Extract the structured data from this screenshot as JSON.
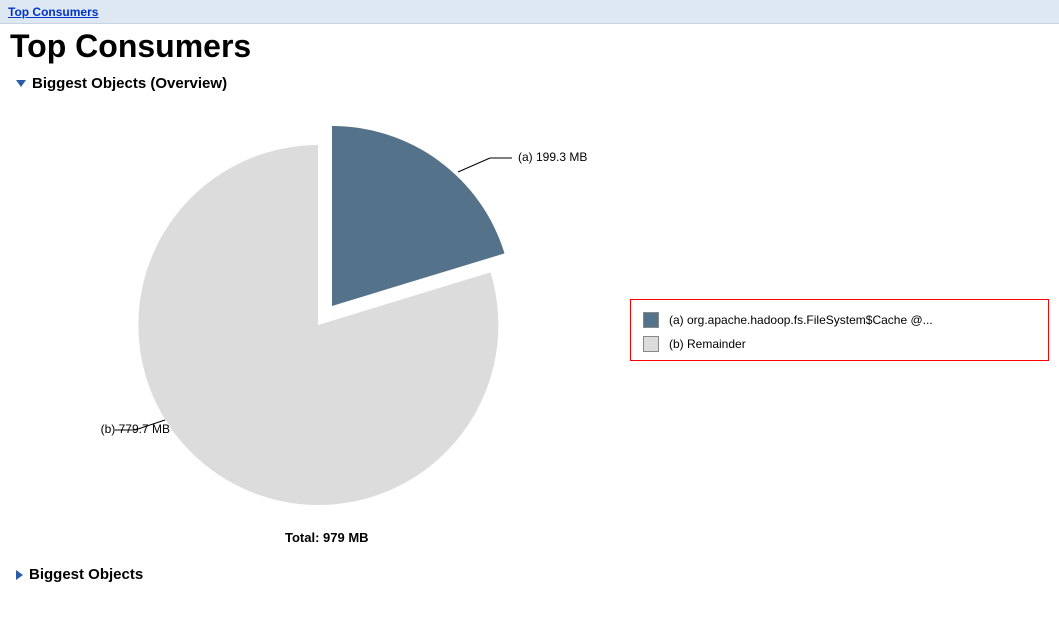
{
  "breadcrumb": {
    "label": "Top Consumers"
  },
  "page": {
    "title": "Top Consumers"
  },
  "section_overview": {
    "title": "Biggest Objects (Overview)",
    "expanded": true
  },
  "section_biggest": {
    "title": "Biggest Objects",
    "expanded": false
  },
  "chart": {
    "callout_a": "(a)  199.3 MB",
    "callout_b": "(b)  779.7 MB",
    "total": "Total: 979 MB"
  },
  "legend": {
    "items": [
      {
        "key": "a",
        "label": "(a)  org.apache.hadoop.fs.FileSystem$Cache @...",
        "color": "#54738a"
      },
      {
        "key": "b",
        "label": "(b)  Remainder",
        "color": "#dcdcdc"
      }
    ]
  },
  "chart_data": {
    "type": "pie",
    "title": "Biggest Objects (Overview)",
    "unit": "MB",
    "total": 979,
    "series": [
      {
        "name": "(a)  org.apache.hadoop.fs.FileSystem$Cache @...",
        "key": "a",
        "value": 199.3,
        "color": "#54738a"
      },
      {
        "name": "(b)  Remainder",
        "key": "b",
        "value": 779.7,
        "color": "#dcdcdc"
      }
    ]
  }
}
